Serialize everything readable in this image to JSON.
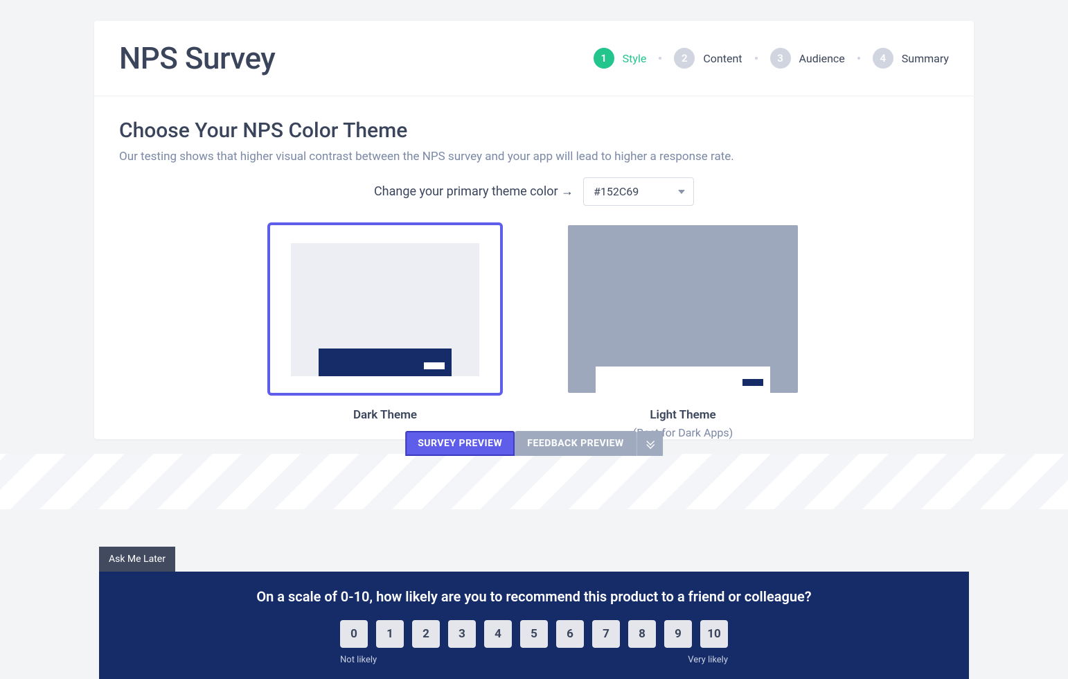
{
  "header": {
    "title": "NPS Survey",
    "steps": [
      {
        "num": "1",
        "label": "Style",
        "active": true
      },
      {
        "num": "2",
        "label": "Content",
        "active": false
      },
      {
        "num": "3",
        "label": "Audience",
        "active": false
      },
      {
        "num": "4",
        "label": "Summary",
        "active": false
      }
    ]
  },
  "section": {
    "title": "Choose Your NPS Color Theme",
    "desc": "Our testing shows that higher visual contrast between the NPS survey and your app will lead to higher a response rate.",
    "color_label": "Change your primary theme color →",
    "color_value": "#152C69"
  },
  "themes": {
    "dark": {
      "name": "Dark Theme"
    },
    "light": {
      "name": "Light Theme",
      "note": "(Best for Dark Apps)"
    }
  },
  "preview_tabs": {
    "survey": "SURVEY PREVIEW",
    "feedback": "FEEDBACK PREVIEW"
  },
  "nps": {
    "ask_later": "Ask Me Later",
    "question": "On a scale of 0-10, how likely are you to recommend this product to a friend or colleague?",
    "scale": [
      "0",
      "1",
      "2",
      "3",
      "4",
      "5",
      "6",
      "7",
      "8",
      "9",
      "10"
    ],
    "low_label": "Not likely",
    "high_label": "Very likely"
  },
  "colors": {
    "primary": "#152C69",
    "accent": "#5e5eea",
    "success": "#22c58b"
  }
}
